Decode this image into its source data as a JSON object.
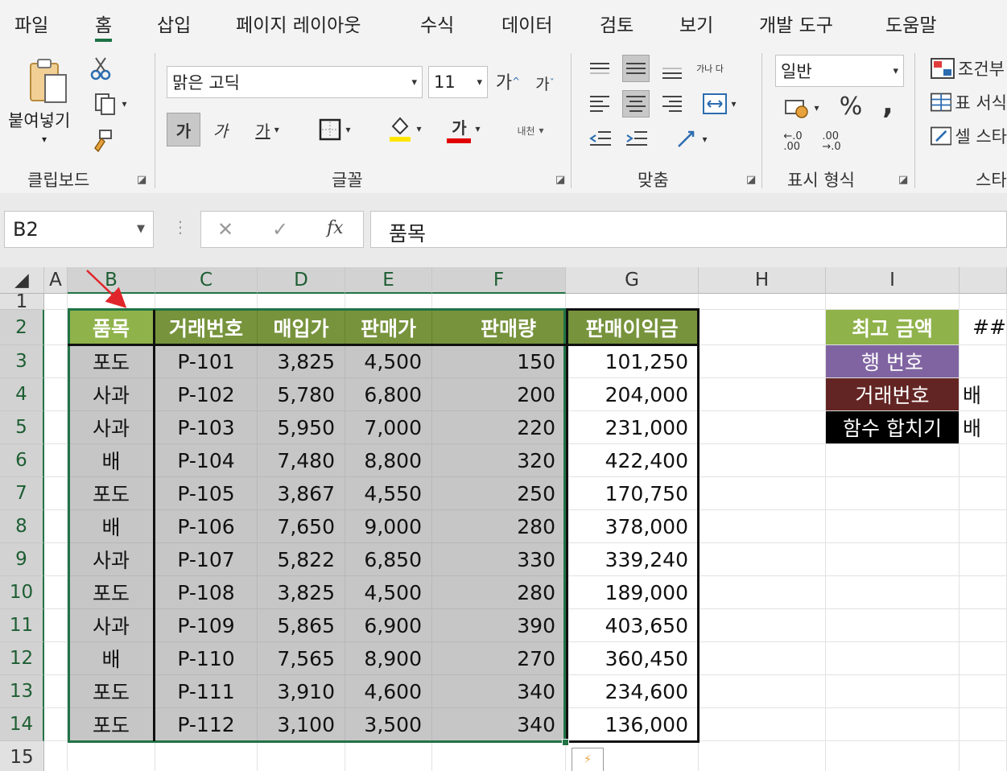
{
  "menu": {
    "tabs": [
      "파일",
      "홈",
      "삽입",
      "페이지 레이아웃",
      "수식",
      "데이터",
      "검토",
      "보기",
      "개발 도구",
      "도움말"
    ],
    "active": "홈"
  },
  "ribbon": {
    "clipboard": {
      "paste_label": "붙여넣기",
      "group_label": "클립보드"
    },
    "font": {
      "font_name": "맑은 고딕",
      "font_size": "11",
      "grow_label": "가",
      "shrink_label": "가",
      "bold_label": "가",
      "italic_label": "가",
      "underline_label": "가",
      "color_label": "가",
      "phonetic_label": "내천",
      "group_label": "글꼴",
      "fill_color": "#ffe600",
      "text_color": "#e00000"
    },
    "alignment": {
      "wrap_label": "가나 다",
      "group_label": "맞춤"
    },
    "number": {
      "format": "일반",
      "percent": "%",
      "comma": ",",
      "group_label": "표시 형식"
    },
    "styles": {
      "conditional": "조건부",
      "table": "표 서식",
      "cell": "셀 스타",
      "group_label": "스타"
    }
  },
  "formula_bar": {
    "name_box": "B2",
    "cancel": "✕",
    "enter": "✓",
    "fx": "fx",
    "content": "품목"
  },
  "columns": [
    "A",
    "B",
    "C",
    "D",
    "E",
    "F",
    "G",
    "H",
    "I"
  ],
  "rows": [
    "1",
    "2",
    "3",
    "4",
    "5",
    "6",
    "7",
    "8",
    "9",
    "10",
    "11",
    "12",
    "13",
    "14",
    "15"
  ],
  "table": {
    "headers": [
      "품목",
      "거래번호",
      "매입가",
      "판매가",
      "판매량"
    ],
    "profit_header": "판매이익금",
    "rows": [
      [
        "포도",
        "P-101",
        "3,825",
        "4,500",
        "150",
        "101,250"
      ],
      [
        "사과",
        "P-102",
        "5,780",
        "6,800",
        "200",
        "204,000"
      ],
      [
        "사과",
        "P-103",
        "5,950",
        "7,000",
        "220",
        "231,000"
      ],
      [
        "배",
        "P-104",
        "7,480",
        "8,800",
        "320",
        "422,400"
      ],
      [
        "포도",
        "P-105",
        "3,867",
        "4,550",
        "250",
        "170,750"
      ],
      [
        "배",
        "P-106",
        "7,650",
        "9,000",
        "280",
        "378,000"
      ],
      [
        "사과",
        "P-107",
        "5,822",
        "6,850",
        "330",
        "339,240"
      ],
      [
        "포도",
        "P-108",
        "3,825",
        "4,500",
        "280",
        "189,000"
      ],
      [
        "사과",
        "P-109",
        "5,865",
        "6,900",
        "390",
        "403,650"
      ],
      [
        "배",
        "P-110",
        "7,565",
        "8,900",
        "270",
        "360,450"
      ],
      [
        "포도",
        "P-111",
        "3,910",
        "4,600",
        "340",
        "234,600"
      ],
      [
        "포도",
        "P-112",
        "3,100",
        "3,500",
        "340",
        "136,000"
      ]
    ]
  },
  "side_table": {
    "labels": [
      "최고 금액",
      "행 번호",
      "거래번호",
      "함수 합치기"
    ],
    "values": [
      "##",
      "",
      "배",
      "배"
    ],
    "colors": [
      "#8fb24a",
      "#8064a2",
      "#632523",
      "#000000"
    ]
  }
}
